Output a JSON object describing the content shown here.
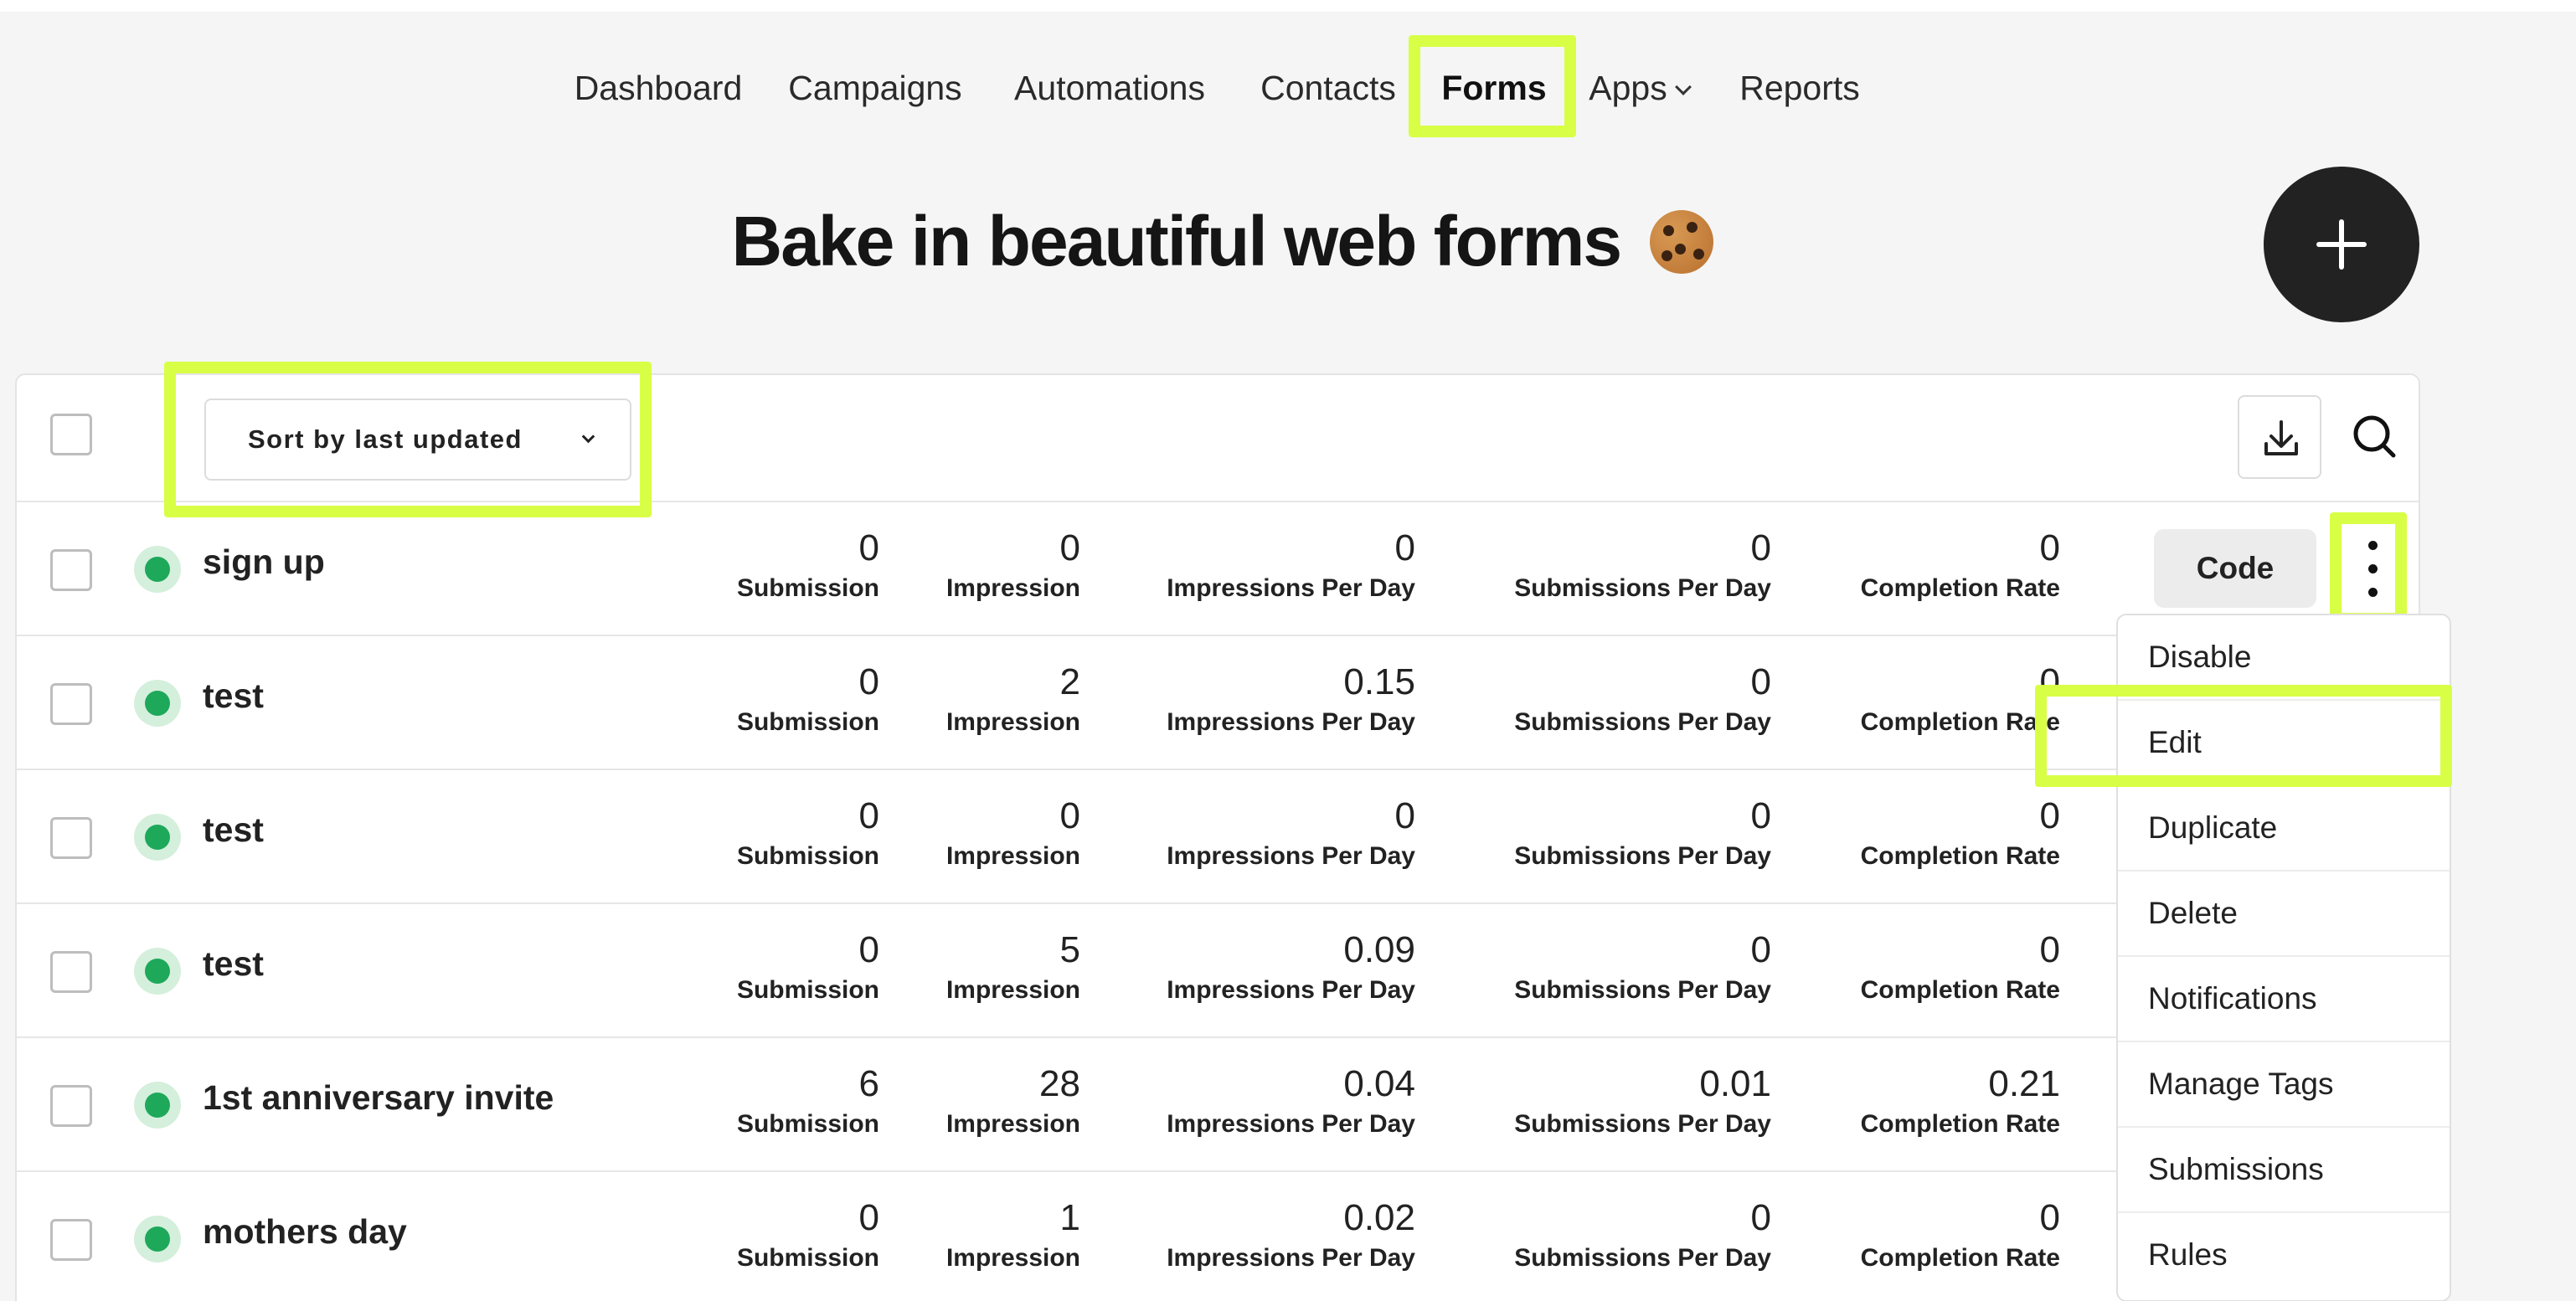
{
  "nav": {
    "items": [
      {
        "label": "Dashboard"
      },
      {
        "label": "Campaigns"
      },
      {
        "label": "Automations"
      },
      {
        "label": "Contacts"
      },
      {
        "label": "Forms"
      },
      {
        "label": "Apps"
      },
      {
        "label": "Reports"
      }
    ]
  },
  "page": {
    "title": "Bake in beautiful web forms"
  },
  "toolbar": {
    "sort_label": "Sort by last updated"
  },
  "labels": {
    "submission": "Submission",
    "impression": "Impression",
    "impressions_per_day": "Impressions Per Day",
    "submissions_per_day": "Submissions Per Day",
    "completion_rate": "Completion Rate",
    "code_button": "Code"
  },
  "forms": [
    {
      "name": "sign up",
      "submission": "0",
      "impression": "0",
      "impressions_per_day": "0",
      "submissions_per_day": "0",
      "completion_rate": "0"
    },
    {
      "name": "test",
      "submission": "0",
      "impression": "2",
      "impressions_per_day": "0.15",
      "submissions_per_day": "0",
      "completion_rate": "0"
    },
    {
      "name": "test",
      "submission": "0",
      "impression": "0",
      "impressions_per_day": "0",
      "submissions_per_day": "0",
      "completion_rate": "0"
    },
    {
      "name": "test",
      "submission": "0",
      "impression": "5",
      "impressions_per_day": "0.09",
      "submissions_per_day": "0",
      "completion_rate": "0"
    },
    {
      "name": "1st anniversary invite",
      "submission": "6",
      "impression": "28",
      "impressions_per_day": "0.04",
      "submissions_per_day": "0.01",
      "completion_rate": "0.21"
    },
    {
      "name": "mothers day",
      "submission": "0",
      "impression": "1",
      "impressions_per_day": "0.02",
      "submissions_per_day": "0",
      "completion_rate": "0"
    }
  ],
  "menu": {
    "items": [
      {
        "label": "Disable"
      },
      {
        "label": "Edit"
      },
      {
        "label": "Duplicate"
      },
      {
        "label": "Delete"
      },
      {
        "label": "Notifications"
      },
      {
        "label": "Manage Tags"
      },
      {
        "label": "Submissions"
      },
      {
        "label": "Rules"
      }
    ]
  },
  "colors": {
    "highlight": "#d8ff45",
    "status_active": "#1ea85a",
    "fab": "#222222"
  }
}
